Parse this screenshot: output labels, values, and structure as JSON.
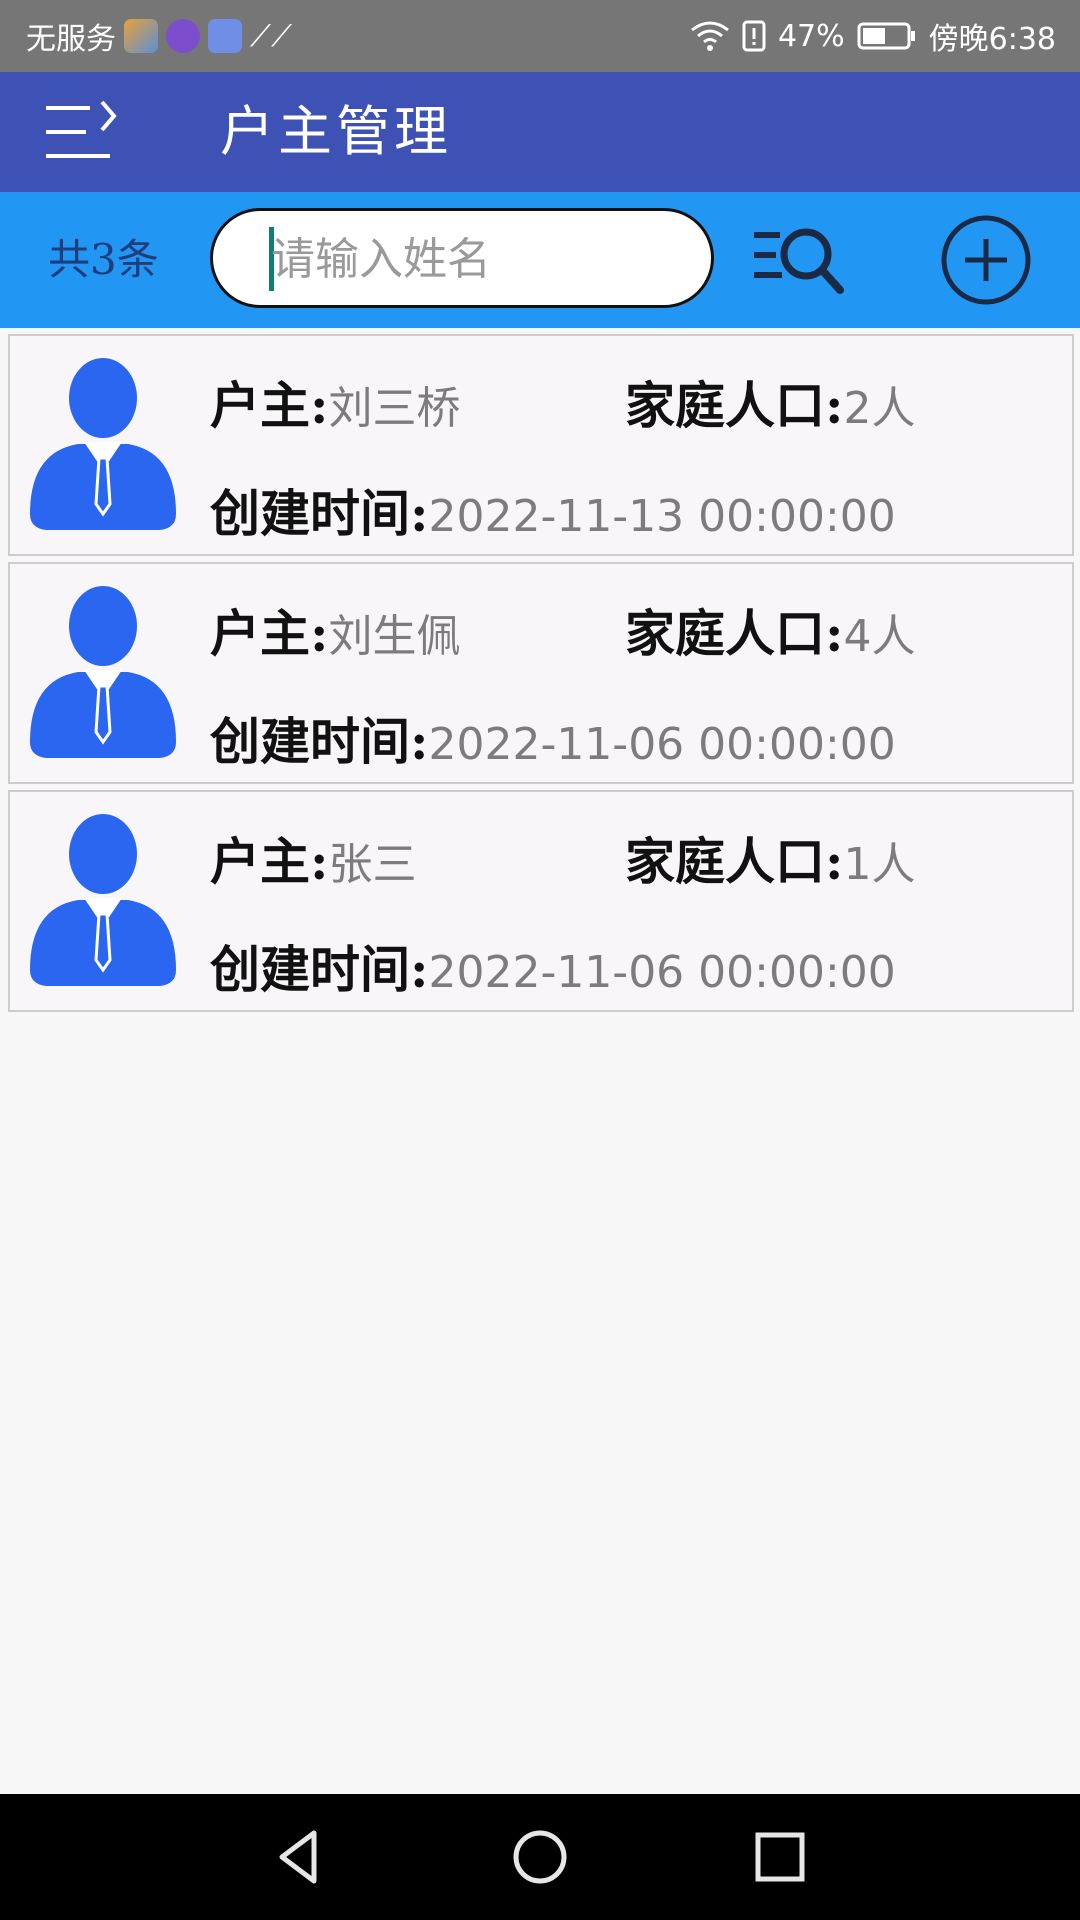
{
  "status_bar": {
    "carrier": "无服务",
    "battery_percent": "47%",
    "time": "傍晚6:38",
    "icons": [
      "game-app-icon",
      "music-app-icon",
      "itunes-app-icon",
      "link-app-icon",
      "wifi-icon",
      "alert-sim-icon",
      "battery-icon"
    ]
  },
  "toolbar": {
    "title": "户主管理",
    "menu_icon": "menu-open-icon"
  },
  "search": {
    "count_label": "共3条",
    "placeholder": "请输入姓名",
    "value": "",
    "search_icon": "list-search-icon",
    "add_icon": "add-circle-icon"
  },
  "labels": {
    "owner": "户主:",
    "family_size": "家庭人口:",
    "created": "创建时间:"
  },
  "households": [
    {
      "owner": "刘三桥",
      "family_size": "2人",
      "created": "2022-11-13  00:00:00"
    },
    {
      "owner": "刘生佩",
      "family_size": "4人",
      "created": "2022-11-06  00:00:00"
    },
    {
      "owner": "张三",
      "family_size": "1人",
      "created": "2022-11-06  00:00:00"
    }
  ],
  "colors": {
    "toolbar_bg": "#3e51b5",
    "searchbar_bg": "#2196f3",
    "avatar_blue": "#2a66f0",
    "status_bg": "#767676"
  },
  "nav": {
    "icons": [
      "back-icon",
      "home-icon",
      "recents-icon"
    ]
  }
}
